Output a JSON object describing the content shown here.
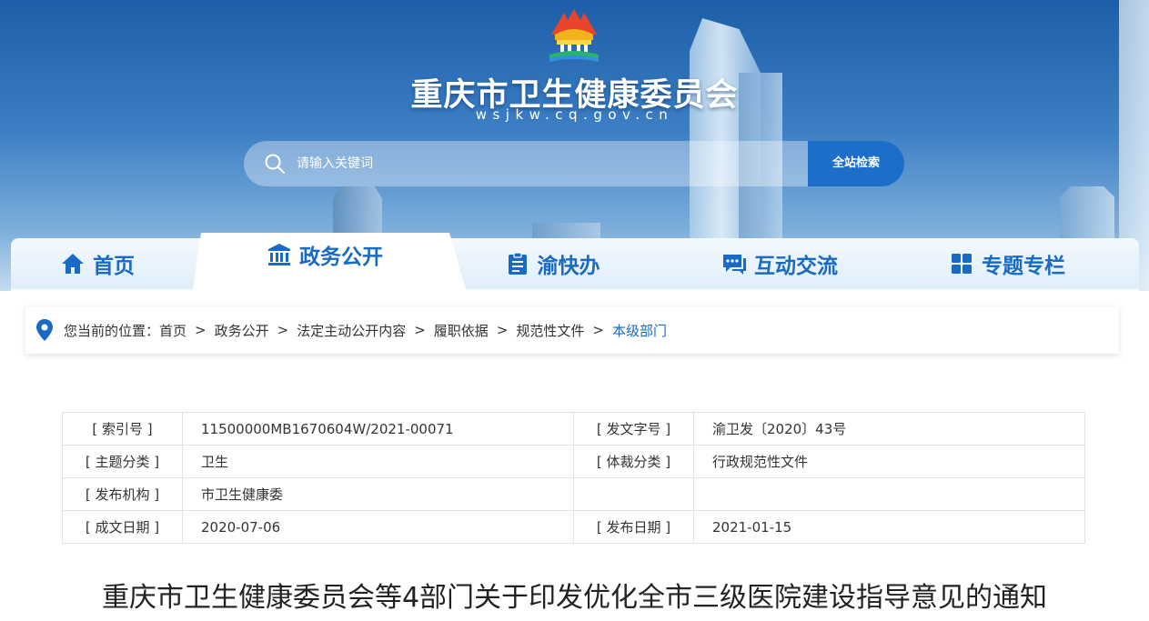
{
  "header": {
    "site_title": "重庆市卫生健康委员会",
    "site_domain": "wsjkw.cq.gov.cn",
    "logo_icon": "city-hall-emblem-icon"
  },
  "search": {
    "placeholder": "请输入关键词",
    "button_label": "全站检索"
  },
  "nav": {
    "items": [
      {
        "label": "首页",
        "icon": "home-icon"
      },
      {
        "label": "政务公开",
        "icon": "government-building-icon",
        "active": true
      },
      {
        "label": "渝快办",
        "icon": "clipboard-icon"
      },
      {
        "label": "互动交流",
        "icon": "chat-bubble-icon"
      },
      {
        "label": "专题专栏",
        "icon": "grid-icon"
      }
    ]
  },
  "breadcrumb": {
    "prefix": "您当前的位置：",
    "items": [
      "首页",
      "政务公开",
      "法定主动公开内容",
      "履职依据",
      "规范性文件"
    ],
    "current": "本级部门",
    "separator": ">"
  },
  "meta_table": {
    "rows": [
      {
        "k1": "[ 索引号 ]",
        "v1": "11500000MB1670604W/2021-00071",
        "k2": "[ 发文字号 ]",
        "v2": "渝卫发〔2020〕43号"
      },
      {
        "k1": "[ 主题分类 ]",
        "v1": "卫生",
        "k2": "[ 体裁分类 ]",
        "v2": "行政规范性文件"
      },
      {
        "k1": "[ 发布机构 ]",
        "v1": "市卫生健康委",
        "k2": "",
        "v2": ""
      },
      {
        "k1": "[ 成文日期 ]",
        "v1": "2020-07-06",
        "k2": "[ 发布日期 ]",
        "v2": "2021-01-15"
      }
    ]
  },
  "document": {
    "title": "重庆市卫生健康委员会等4部门关于印发优化全市三级医院建设指导意见的通知"
  },
  "colors": {
    "brand_blue": "#1a6ac3",
    "search_button": "#1c6ec8"
  }
}
